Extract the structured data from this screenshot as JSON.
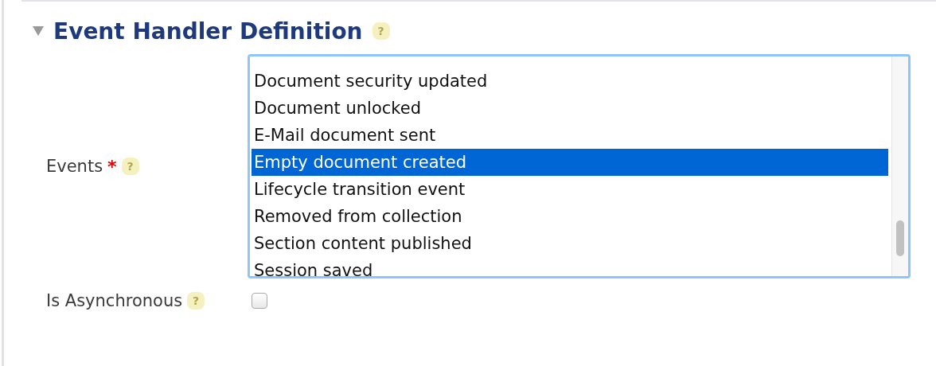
{
  "section": {
    "title": "Event Handler Definition",
    "expanded": true,
    "help": "?"
  },
  "fields": [
    {
      "kind": "listbox",
      "label": "Events",
      "required": true,
      "required_mark": "*",
      "help": "?",
      "options": [
        {
          "label": "Document security updated",
          "selected": false
        },
        {
          "label": "Document unlocked",
          "selected": false
        },
        {
          "label": "E-Mail document sent",
          "selected": false
        },
        {
          "label": "Empty document created",
          "selected": true
        },
        {
          "label": "Lifecycle transition event",
          "selected": false
        },
        {
          "label": "Removed from collection",
          "selected": false
        },
        {
          "label": "Section content published",
          "selected": false
        },
        {
          "label": "Session saved",
          "selected": false
        }
      ]
    },
    {
      "kind": "checkbox",
      "label": "Is Asynchronous",
      "required": false,
      "help": "?",
      "checked": false
    }
  ]
}
